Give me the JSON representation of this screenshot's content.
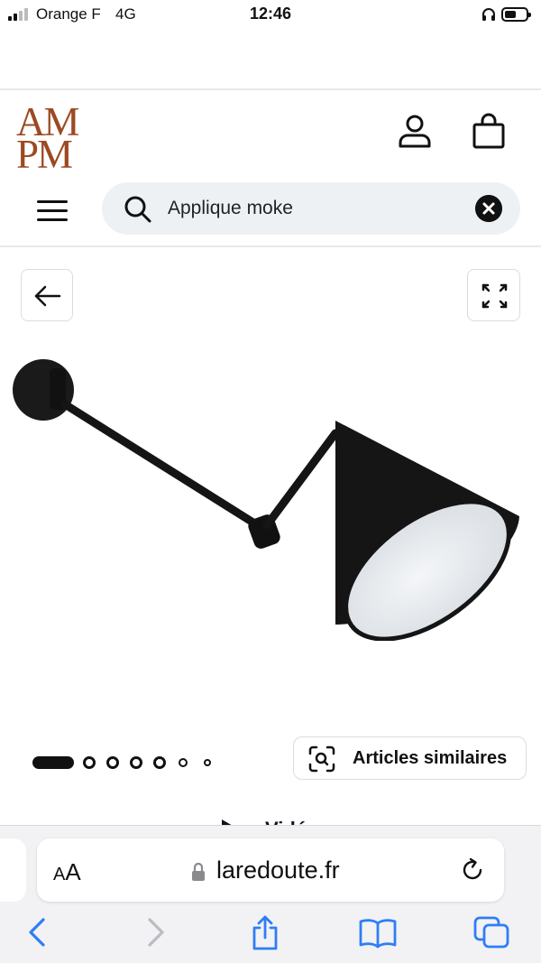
{
  "status_bar": {
    "carrier": "Orange F",
    "network": "4G",
    "time": "12:46"
  },
  "header": {
    "logo_line1": "AM",
    "logo_line2": "PM",
    "logo_color": "#9c4a22",
    "search_value": "Applique moke",
    "search_bg": "#eef1f4"
  },
  "product": {
    "carousel_total": 7,
    "carousel_active": 1,
    "similar_label": "Articles similaires",
    "video_label": "Vidéo"
  },
  "browser": {
    "aa_label_small": "A",
    "aa_label_large": "A",
    "url": "laredoute.fr",
    "accent": "#2f7df6"
  }
}
